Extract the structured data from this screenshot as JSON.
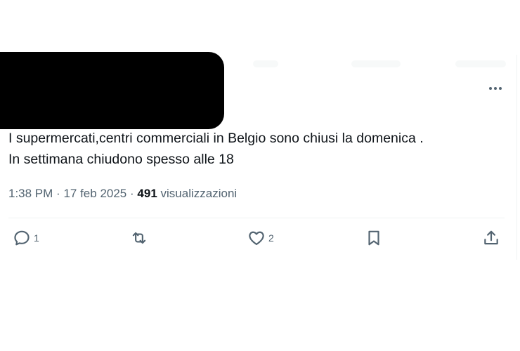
{
  "post": {
    "text_lines": [
      "I supermercati,centri commerciali in Belgio sono chiusi la domenica .",
      "In settimana chiudono spesso alle 18"
    ],
    "time": "1:38 PM",
    "separator": "·",
    "date": "17 feb 2025",
    "views_count": "491",
    "views_label": "visualizzazioni"
  },
  "actions": {
    "reply_count": "1",
    "like_count": "2"
  },
  "icons": {
    "more": "more-dots-icon",
    "reply": "reply-icon",
    "repost": "repost-icon",
    "like": "heart-icon",
    "bookmark": "bookmark-icon",
    "share": "share-icon"
  },
  "colors": {
    "text": "#0f1419",
    "secondary": "#536471",
    "divider": "#eff3f4",
    "redaction": "#000000"
  }
}
